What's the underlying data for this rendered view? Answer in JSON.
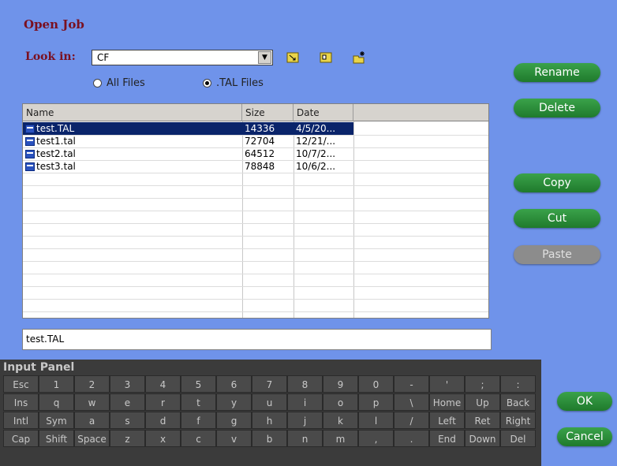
{
  "dialog": {
    "title": "Open Job"
  },
  "lookin": {
    "label": "Look in:",
    "value": "CF"
  },
  "toolbar": {
    "icons": [
      "folder-up-icon",
      "folder-icon",
      "new-folder-icon"
    ]
  },
  "filter": {
    "all_label": "All Files",
    "tal_label": ".TAL Files",
    "selected": ".TAL Files"
  },
  "list": {
    "columns": [
      "Name",
      "Size",
      "Date"
    ],
    "rows": [
      {
        "name": "test.TAL",
        "size": "14336",
        "date": "4/5/20...",
        "selected": true
      },
      {
        "name": "test1.tal",
        "size": "72704",
        "date": "12/21/...",
        "selected": false
      },
      {
        "name": "test2.tal",
        "size": "64512",
        "date": "10/7/2...",
        "selected": false
      },
      {
        "name": "test3.tal",
        "size": "78848",
        "date": "10/6/2...",
        "selected": false
      }
    ]
  },
  "filename": {
    "value": "test.TAL"
  },
  "buttons": {
    "rename": "Rename",
    "delete": "Delete",
    "copy": "Copy",
    "cut": "Cut",
    "paste": "Paste",
    "ok": "OK",
    "cancel": "Cancel"
  },
  "input_panel": {
    "title": "Input Panel",
    "rows": [
      [
        "Esc",
        "1",
        "2",
        "3",
        "4",
        "5",
        "6",
        "7",
        "8",
        "9",
        "0",
        "-",
        "'",
        ";",
        ":"
      ],
      [
        "Ins",
        "q",
        "w",
        "e",
        "r",
        "t",
        "y",
        "u",
        "i",
        "o",
        "p",
        "\\",
        "Home",
        "Up",
        "Back"
      ],
      [
        "Intl",
        "Sym",
        "a",
        "s",
        "d",
        "f",
        "g",
        "h",
        "j",
        "k",
        "l",
        "/",
        "Left",
        "Ret",
        "Right"
      ],
      [
        "Cap",
        "Shift",
        "Space",
        "z",
        "x",
        "c",
        "v",
        "b",
        "n",
        "m",
        ",",
        ".",
        "End",
        "Down",
        "Del"
      ]
    ]
  },
  "colors": {
    "background": "#6f93ea",
    "button_green": "#2a8f3a",
    "selection": "#0a246a",
    "title_red": "#7a1020"
  }
}
